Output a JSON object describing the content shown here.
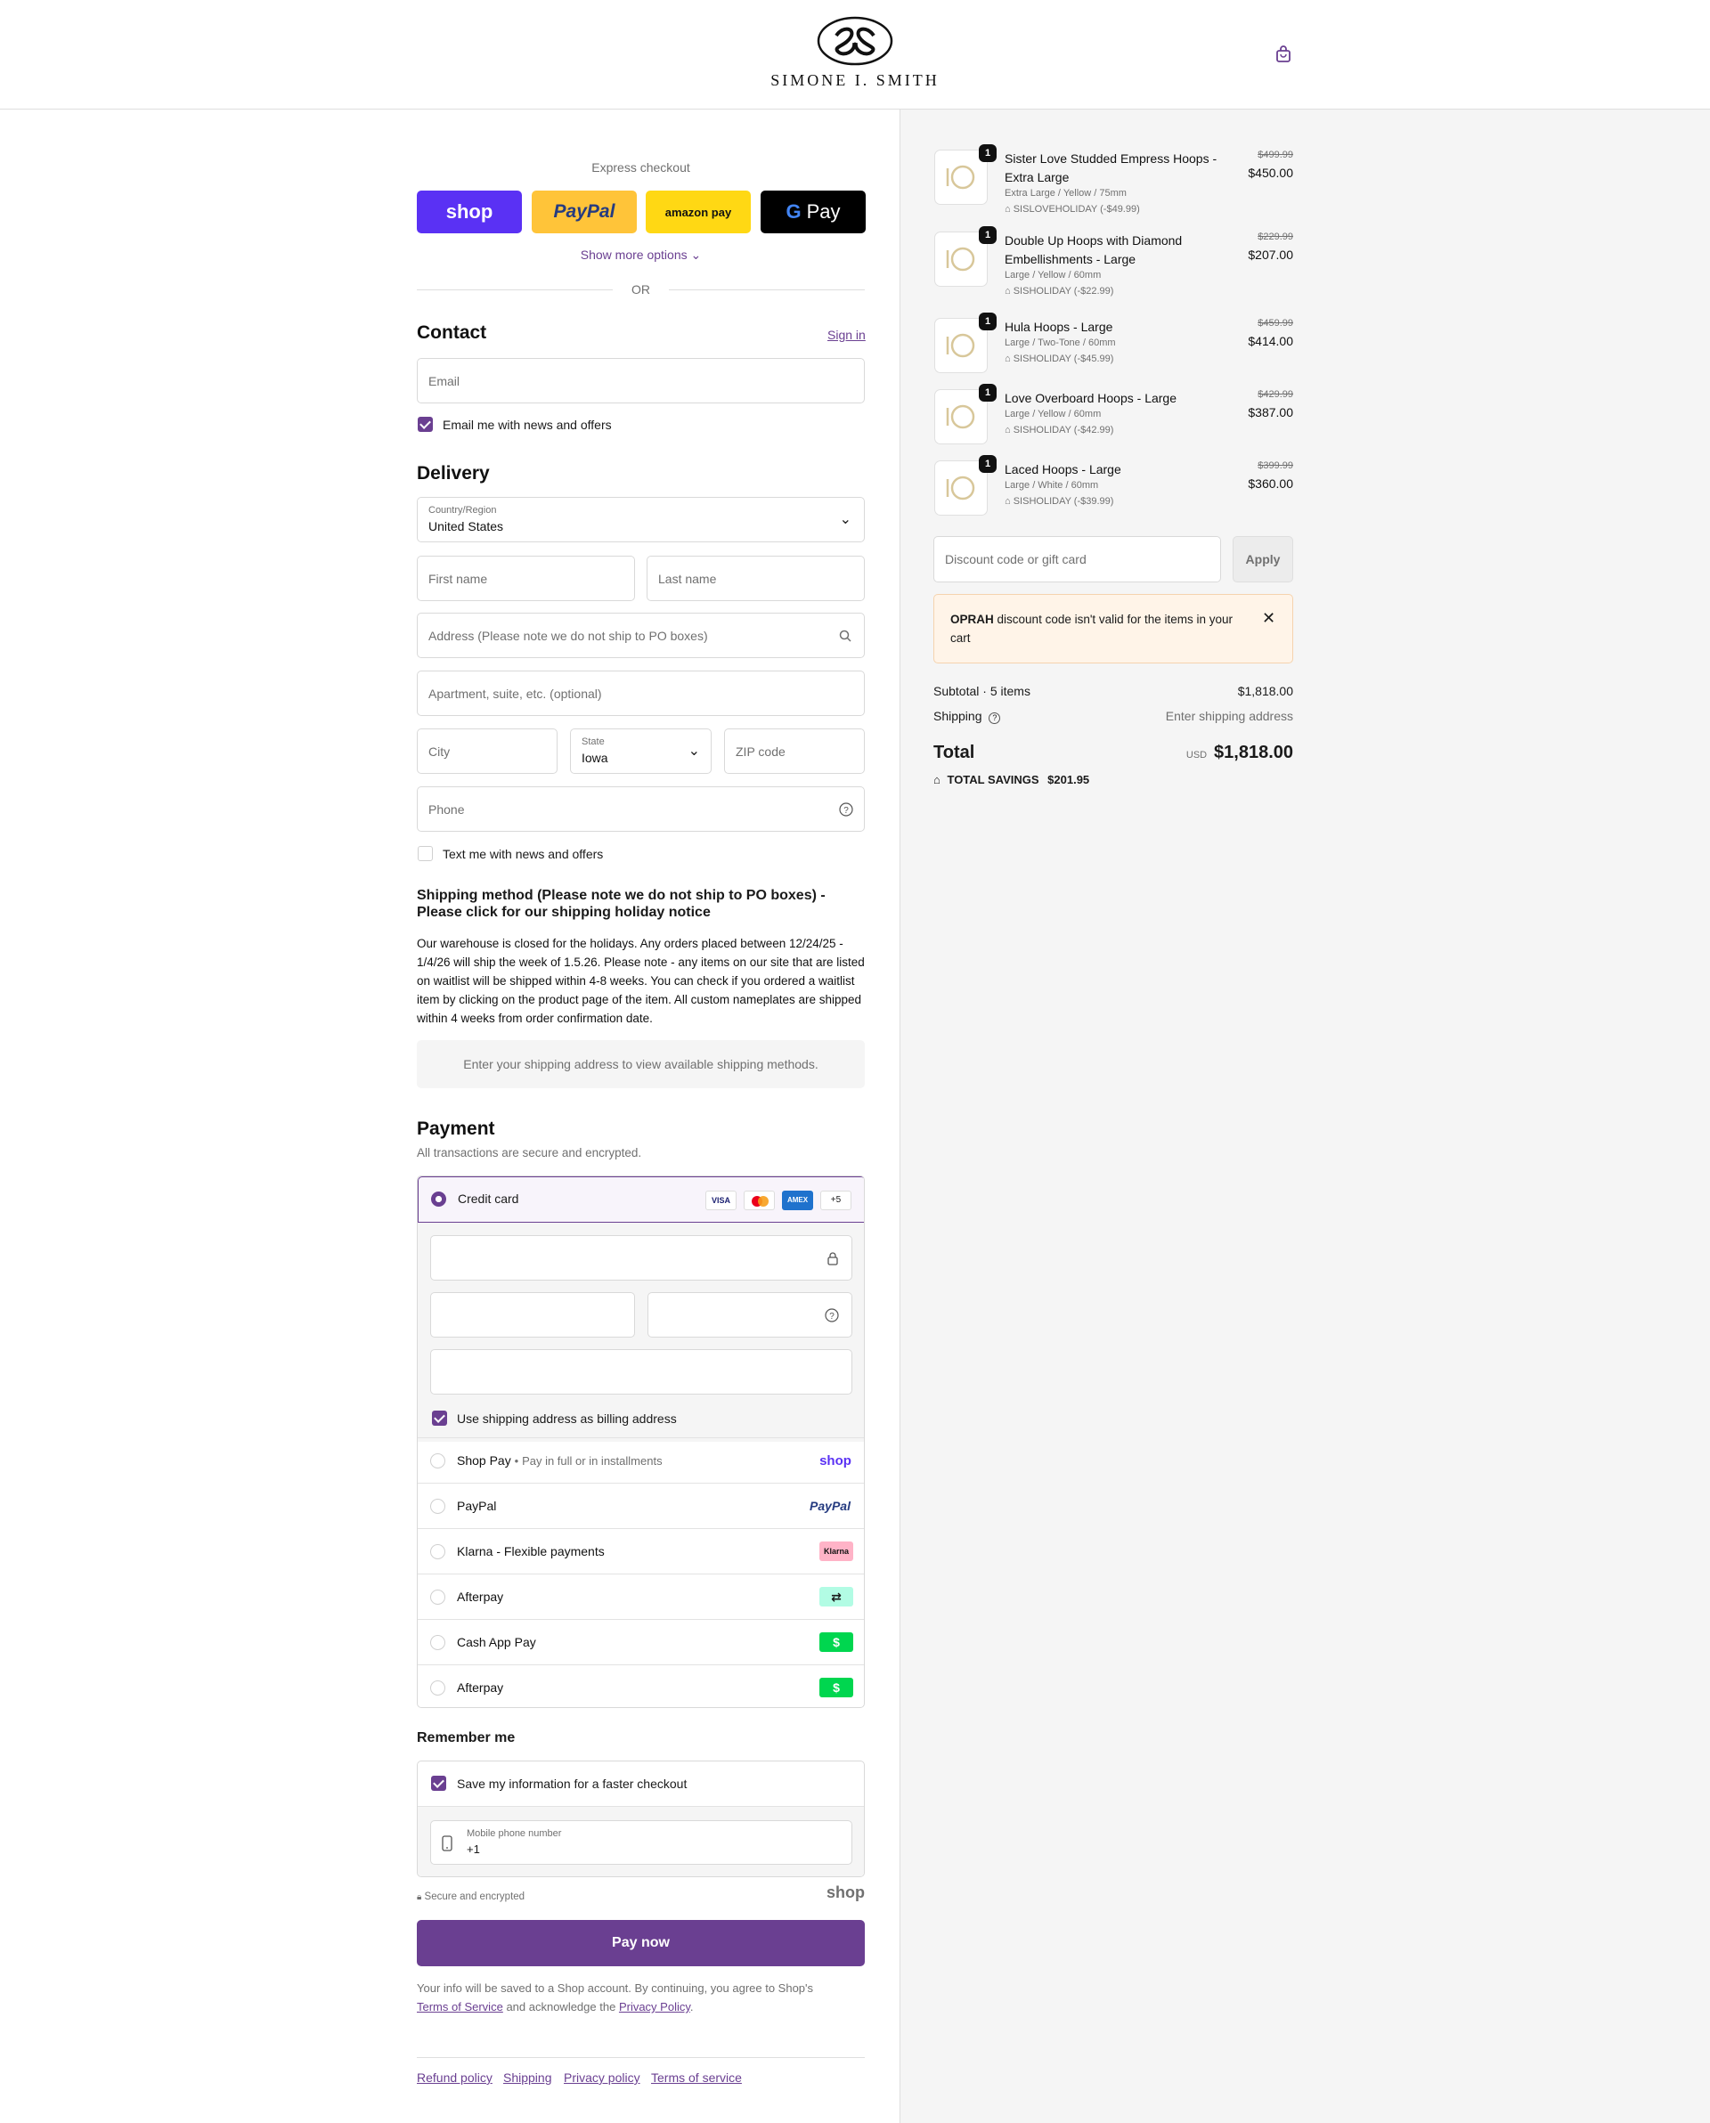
{
  "brand": {
    "name": "SIMONE I. SMITH"
  },
  "express": {
    "title": "Express checkout",
    "buttons": [
      "shop",
      "PayPal",
      "amazon pay",
      "Pay"
    ],
    "more": "Show more options",
    "or": "OR"
  },
  "contact": {
    "title": "Contact",
    "signin": "Sign in",
    "email_placeholder": "Email",
    "news_label": "Email me with news and offers"
  },
  "delivery": {
    "title": "Delivery",
    "country_label": "Country/Region",
    "country_value": "United States",
    "first_name": "First name",
    "last_name": "Last name",
    "address": "Address (Please note we do not ship to PO boxes)",
    "apartment": "Apartment, suite, etc. (optional)",
    "city": "City",
    "state_label": "State",
    "state_value": "Iowa",
    "zip": "ZIP code",
    "phone": "Phone",
    "text_label": "Text me with news and offers"
  },
  "shipping": {
    "title": "Shipping method (Please note we do not ship to PO boxes) - Please click for our shipping holiday notice",
    "body": "Our warehouse is closed for the holidays. Any orders placed between 12/24/25 - 1/4/26 will ship the week of 1.5.26. Please note - any items on our site that are listed on waitlist will be shipped within 4-8 weeks. You can check if you ordered a waitlist item by clicking on the product page of the item. All custom nameplates are shipped within 4 weeks from order confirmation date.",
    "notice": "Enter your shipping address to view available shipping methods."
  },
  "payment": {
    "title": "Payment",
    "subtitle": "All transactions are secure and encrypted.",
    "credit_card": "Credit card",
    "card_brands": [
      "VISA",
      "MC",
      "AMEX",
      "+5"
    ],
    "billing_label": "Use shipping address as billing address",
    "methods": [
      {
        "name": "Shop Pay",
        "sub": "Pay in full or in installments",
        "badge": "shop"
      },
      {
        "name": "PayPal",
        "sub": "",
        "badge": "PayPal"
      },
      {
        "name": "Klarna - Flexible payments",
        "sub": "",
        "badge": "Klarna"
      },
      {
        "name": "Afterpay",
        "sub": "",
        "badge": "afterpay"
      },
      {
        "name": "Cash App Pay",
        "sub": "",
        "badge": "$"
      },
      {
        "name": "Afterpay",
        "sub": "",
        "badge": "$"
      }
    ]
  },
  "remember": {
    "title": "Remember me",
    "save_label": "Save my information for a faster checkout",
    "mobile_label": "Mobile phone number",
    "mobile_value": "+1",
    "secure": "Secure and encrypted",
    "shop": "shop"
  },
  "pay_now": "Pay now",
  "legal": {
    "text1": "Your info will be saved to a Shop account. By continuing, you agree to Shop's",
    "terms": "Terms of Service",
    "and": "and acknowledge the",
    "privacy": "Privacy Policy",
    "end": "."
  },
  "footer_links": [
    "Refund policy",
    "Shipping",
    "Privacy policy",
    "Terms of service"
  ],
  "cart": {
    "items": [
      {
        "qty": "1",
        "title": "Sister Love Studded Empress Hoops - Extra Large",
        "variant": "Extra Large / Yellow / 75mm",
        "discount": "SISLOVEHOLIDAY (-$49.99)",
        "old": "$499.99",
        "new": "$450.00"
      },
      {
        "qty": "1",
        "title": "Double Up Hoops with Diamond Embellishments - Large",
        "variant": "Large / Yellow / 60mm",
        "discount": "SISHOLIDAY (-$22.99)",
        "old": "$229.99",
        "new": "$207.00"
      },
      {
        "qty": "1",
        "title": "Hula Hoops - Large",
        "variant": "Large / Two-Tone / 60mm",
        "discount": "SISHOLIDAY (-$45.99)",
        "old": "$459.99",
        "new": "$414.00"
      },
      {
        "qty": "1",
        "title": "Love Overboard Hoops - Large",
        "variant": "Large / Yellow / 60mm",
        "discount": "SISHOLIDAY (-$42.99)",
        "old": "$429.99",
        "new": "$387.00"
      },
      {
        "qty": "1",
        "title": "Laced Hoops - Large",
        "variant": "Large / White / 60mm",
        "discount": "SISHOLIDAY (-$39.99)",
        "old": "$399.99",
        "new": "$360.00"
      }
    ],
    "discount_placeholder": "Discount code or gift card",
    "apply": "Apply",
    "error_code": "OPRAH",
    "error_text": "discount code isn't valid for the items in your cart",
    "subtotal_label": "Subtotal · 5 items",
    "subtotal_value": "$1,818.00",
    "shipping_label": "Shipping",
    "shipping_value": "Enter shipping address",
    "total_label": "Total",
    "currency": "USD",
    "total_value": "$1,818.00",
    "savings_label": "TOTAL SAVINGS",
    "savings_value": "$201.95"
  },
  "colors": {
    "accent": "#6a3f91",
    "shop": "#5a31f4",
    "paypal": "#ffc439",
    "amazon": "#ffd814",
    "gpay": "#000000"
  }
}
